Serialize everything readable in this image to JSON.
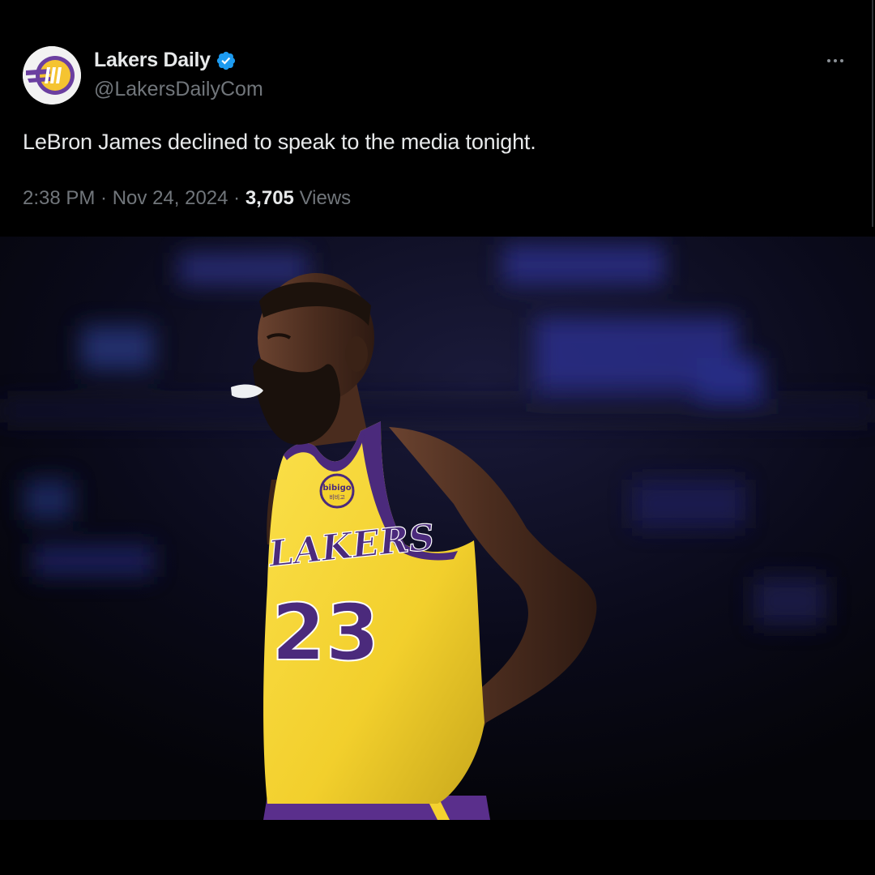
{
  "tweet": {
    "display_name": "Lakers Daily",
    "handle": "@LakersDailyCom",
    "verified": true,
    "text": "LeBron James declined to speak to the media tonight.",
    "time": "2:38 PM",
    "date": "Nov 24, 2024",
    "views_count": "3,705",
    "views_label": "Views",
    "separator": " · "
  },
  "photo": {
    "jersey_team": "LAKERS",
    "jersey_number": "23",
    "jersey_sponsor_line1": "bibigo",
    "jersey_sponsor_line2": "비비고",
    "jersey_color": "#f5d22e",
    "trim_color": "#4b2a7c"
  },
  "colors": {
    "background": "#000000",
    "text_primary": "#e7e9ea",
    "text_secondary": "#71767b",
    "verified_blue": "#1d9bf0"
  },
  "icons": {
    "avatar": "lakers-daily-logo-icon",
    "verified": "verified-badge-icon",
    "more": "more-options-icon"
  }
}
